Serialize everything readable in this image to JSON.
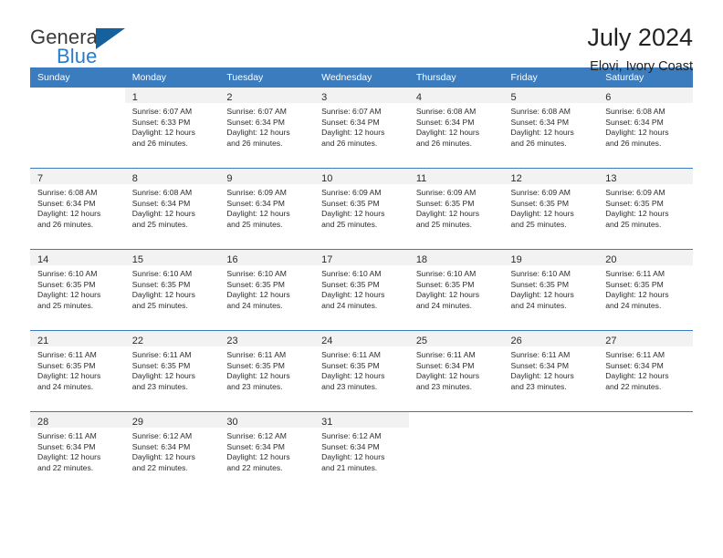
{
  "brand": {
    "name_part1": "General",
    "name_part2": "Blue",
    "logo_icon": "triangle-logo-icon",
    "accent_color": "#14619e",
    "blue_text_color": "#2a7cc7"
  },
  "header": {
    "title": "July 2024",
    "subtitle": "Elovi, Ivory Coast"
  },
  "calendar": {
    "header_bg": "#3a7cbe",
    "daynum_band_bg": "#f2f2f2",
    "weekdays": [
      "Sunday",
      "Monday",
      "Tuesday",
      "Wednesday",
      "Thursday",
      "Friday",
      "Saturday"
    ],
    "weeks": [
      [
        {
          "day": "",
          "sunrise": "",
          "sunset": "",
          "daylight_line1": "",
          "daylight_line2": "",
          "empty": true
        },
        {
          "day": "1",
          "sunrise": "Sunrise: 6:07 AM",
          "sunset": "Sunset: 6:33 PM",
          "daylight_line1": "Daylight: 12 hours",
          "daylight_line2": "and 26 minutes."
        },
        {
          "day": "2",
          "sunrise": "Sunrise: 6:07 AM",
          "sunset": "Sunset: 6:34 PM",
          "daylight_line1": "Daylight: 12 hours",
          "daylight_line2": "and 26 minutes."
        },
        {
          "day": "3",
          "sunrise": "Sunrise: 6:07 AM",
          "sunset": "Sunset: 6:34 PM",
          "daylight_line1": "Daylight: 12 hours",
          "daylight_line2": "and 26 minutes."
        },
        {
          "day": "4",
          "sunrise": "Sunrise: 6:08 AM",
          "sunset": "Sunset: 6:34 PM",
          "daylight_line1": "Daylight: 12 hours",
          "daylight_line2": "and 26 minutes."
        },
        {
          "day": "5",
          "sunrise": "Sunrise: 6:08 AM",
          "sunset": "Sunset: 6:34 PM",
          "daylight_line1": "Daylight: 12 hours",
          "daylight_line2": "and 26 minutes."
        },
        {
          "day": "6",
          "sunrise": "Sunrise: 6:08 AM",
          "sunset": "Sunset: 6:34 PM",
          "daylight_line1": "Daylight: 12 hours",
          "daylight_line2": "and 26 minutes."
        }
      ],
      [
        {
          "day": "7",
          "sunrise": "Sunrise: 6:08 AM",
          "sunset": "Sunset: 6:34 PM",
          "daylight_line1": "Daylight: 12 hours",
          "daylight_line2": "and 26 minutes."
        },
        {
          "day": "8",
          "sunrise": "Sunrise: 6:08 AM",
          "sunset": "Sunset: 6:34 PM",
          "daylight_line1": "Daylight: 12 hours",
          "daylight_line2": "and 25 minutes."
        },
        {
          "day": "9",
          "sunrise": "Sunrise: 6:09 AM",
          "sunset": "Sunset: 6:34 PM",
          "daylight_line1": "Daylight: 12 hours",
          "daylight_line2": "and 25 minutes."
        },
        {
          "day": "10",
          "sunrise": "Sunrise: 6:09 AM",
          "sunset": "Sunset: 6:35 PM",
          "daylight_line1": "Daylight: 12 hours",
          "daylight_line2": "and 25 minutes."
        },
        {
          "day": "11",
          "sunrise": "Sunrise: 6:09 AM",
          "sunset": "Sunset: 6:35 PM",
          "daylight_line1": "Daylight: 12 hours",
          "daylight_line2": "and 25 minutes."
        },
        {
          "day": "12",
          "sunrise": "Sunrise: 6:09 AM",
          "sunset": "Sunset: 6:35 PM",
          "daylight_line1": "Daylight: 12 hours",
          "daylight_line2": "and 25 minutes."
        },
        {
          "day": "13",
          "sunrise": "Sunrise: 6:09 AM",
          "sunset": "Sunset: 6:35 PM",
          "daylight_line1": "Daylight: 12 hours",
          "daylight_line2": "and 25 minutes."
        }
      ],
      [
        {
          "day": "14",
          "sunrise": "Sunrise: 6:10 AM",
          "sunset": "Sunset: 6:35 PM",
          "daylight_line1": "Daylight: 12 hours",
          "daylight_line2": "and 25 minutes."
        },
        {
          "day": "15",
          "sunrise": "Sunrise: 6:10 AM",
          "sunset": "Sunset: 6:35 PM",
          "daylight_line1": "Daylight: 12 hours",
          "daylight_line2": "and 25 minutes."
        },
        {
          "day": "16",
          "sunrise": "Sunrise: 6:10 AM",
          "sunset": "Sunset: 6:35 PM",
          "daylight_line1": "Daylight: 12 hours",
          "daylight_line2": "and 24 minutes."
        },
        {
          "day": "17",
          "sunrise": "Sunrise: 6:10 AM",
          "sunset": "Sunset: 6:35 PM",
          "daylight_line1": "Daylight: 12 hours",
          "daylight_line2": "and 24 minutes."
        },
        {
          "day": "18",
          "sunrise": "Sunrise: 6:10 AM",
          "sunset": "Sunset: 6:35 PM",
          "daylight_line1": "Daylight: 12 hours",
          "daylight_line2": "and 24 minutes."
        },
        {
          "day": "19",
          "sunrise": "Sunrise: 6:10 AM",
          "sunset": "Sunset: 6:35 PM",
          "daylight_line1": "Daylight: 12 hours",
          "daylight_line2": "and 24 minutes."
        },
        {
          "day": "20",
          "sunrise": "Sunrise: 6:11 AM",
          "sunset": "Sunset: 6:35 PM",
          "daylight_line1": "Daylight: 12 hours",
          "daylight_line2": "and 24 minutes."
        }
      ],
      [
        {
          "day": "21",
          "sunrise": "Sunrise: 6:11 AM",
          "sunset": "Sunset: 6:35 PM",
          "daylight_line1": "Daylight: 12 hours",
          "daylight_line2": "and 24 minutes."
        },
        {
          "day": "22",
          "sunrise": "Sunrise: 6:11 AM",
          "sunset": "Sunset: 6:35 PM",
          "daylight_line1": "Daylight: 12 hours",
          "daylight_line2": "and 23 minutes."
        },
        {
          "day": "23",
          "sunrise": "Sunrise: 6:11 AM",
          "sunset": "Sunset: 6:35 PM",
          "daylight_line1": "Daylight: 12 hours",
          "daylight_line2": "and 23 minutes."
        },
        {
          "day": "24",
          "sunrise": "Sunrise: 6:11 AM",
          "sunset": "Sunset: 6:35 PM",
          "daylight_line1": "Daylight: 12 hours",
          "daylight_line2": "and 23 minutes."
        },
        {
          "day": "25",
          "sunrise": "Sunrise: 6:11 AM",
          "sunset": "Sunset: 6:34 PM",
          "daylight_line1": "Daylight: 12 hours",
          "daylight_line2": "and 23 minutes."
        },
        {
          "day": "26",
          "sunrise": "Sunrise: 6:11 AM",
          "sunset": "Sunset: 6:34 PM",
          "daylight_line1": "Daylight: 12 hours",
          "daylight_line2": "and 23 minutes."
        },
        {
          "day": "27",
          "sunrise": "Sunrise: 6:11 AM",
          "sunset": "Sunset: 6:34 PM",
          "daylight_line1": "Daylight: 12 hours",
          "daylight_line2": "and 22 minutes."
        }
      ],
      [
        {
          "day": "28",
          "sunrise": "Sunrise: 6:11 AM",
          "sunset": "Sunset: 6:34 PM",
          "daylight_line1": "Daylight: 12 hours",
          "daylight_line2": "and 22 minutes."
        },
        {
          "day": "29",
          "sunrise": "Sunrise: 6:12 AM",
          "sunset": "Sunset: 6:34 PM",
          "daylight_line1": "Daylight: 12 hours",
          "daylight_line2": "and 22 minutes."
        },
        {
          "day": "30",
          "sunrise": "Sunrise: 6:12 AM",
          "sunset": "Sunset: 6:34 PM",
          "daylight_line1": "Daylight: 12 hours",
          "daylight_line2": "and 22 minutes."
        },
        {
          "day": "31",
          "sunrise": "Sunrise: 6:12 AM",
          "sunset": "Sunset: 6:34 PM",
          "daylight_line1": "Daylight: 12 hours",
          "daylight_line2": "and 21 minutes."
        },
        {
          "day": "",
          "sunrise": "",
          "sunset": "",
          "daylight_line1": "",
          "daylight_line2": "",
          "empty": true
        },
        {
          "day": "",
          "sunrise": "",
          "sunset": "",
          "daylight_line1": "",
          "daylight_line2": "",
          "empty": true
        },
        {
          "day": "",
          "sunrise": "",
          "sunset": "",
          "daylight_line1": "",
          "daylight_line2": "",
          "empty": true
        }
      ]
    ]
  }
}
